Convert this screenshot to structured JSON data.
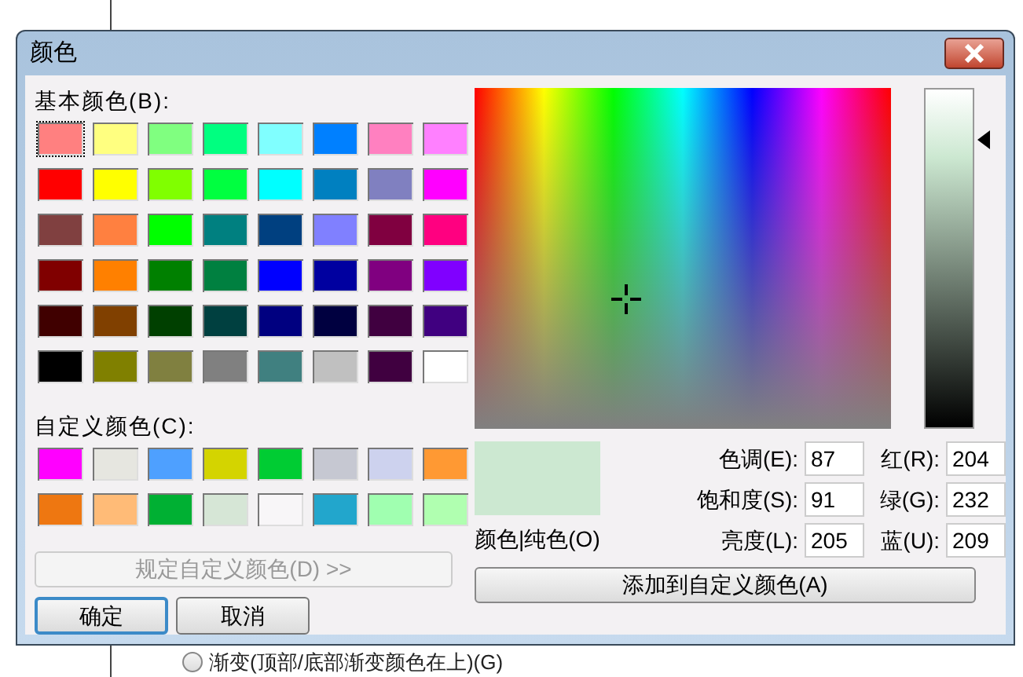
{
  "background_window": {
    "radio": {
      "label": "渐变(顶部/底部渐变颜色在上)(G)",
      "selected": false
    }
  },
  "window": {
    "title": "颜色"
  },
  "basic_colors": {
    "label": "基本颜色(B):",
    "swatches": [
      {
        "color": "#ff8080",
        "selected": true
      },
      {
        "color": "#ffff80",
        "selected": false
      },
      {
        "color": "#80ff80",
        "selected": false
      },
      {
        "color": "#00ff80",
        "selected": false
      },
      {
        "color": "#80ffff",
        "selected": false
      },
      {
        "color": "#0080ff",
        "selected": false
      },
      {
        "color": "#ff80c0",
        "selected": false
      },
      {
        "color": "#ff80ff",
        "selected": false
      },
      {
        "color": "#ff0000",
        "selected": false
      },
      {
        "color": "#ffff00",
        "selected": false
      },
      {
        "color": "#80ff00",
        "selected": false
      },
      {
        "color": "#00ff40",
        "selected": false
      },
      {
        "color": "#00ffff",
        "selected": false
      },
      {
        "color": "#0080c0",
        "selected": false
      },
      {
        "color": "#8080c0",
        "selected": false
      },
      {
        "color": "#ff00ff",
        "selected": false
      },
      {
        "color": "#804040",
        "selected": false
      },
      {
        "color": "#ff8040",
        "selected": false
      },
      {
        "color": "#00ff00",
        "selected": false
      },
      {
        "color": "#008080",
        "selected": false
      },
      {
        "color": "#004080",
        "selected": false
      },
      {
        "color": "#8080ff",
        "selected": false
      },
      {
        "color": "#800040",
        "selected": false
      },
      {
        "color": "#ff0080",
        "selected": false
      },
      {
        "color": "#800000",
        "selected": false
      },
      {
        "color": "#ff8000",
        "selected": false
      },
      {
        "color": "#008000",
        "selected": false
      },
      {
        "color": "#008040",
        "selected": false
      },
      {
        "color": "#0000ff",
        "selected": false
      },
      {
        "color": "#0000a0",
        "selected": false
      },
      {
        "color": "#800080",
        "selected": false
      },
      {
        "color": "#8000ff",
        "selected": false
      },
      {
        "color": "#400000",
        "selected": false
      },
      {
        "color": "#804000",
        "selected": false
      },
      {
        "color": "#004000",
        "selected": false
      },
      {
        "color": "#004040",
        "selected": false
      },
      {
        "color": "#000080",
        "selected": false
      },
      {
        "color": "#000040",
        "selected": false
      },
      {
        "color": "#400040",
        "selected": false
      },
      {
        "color": "#400080",
        "selected": false
      },
      {
        "color": "#000000",
        "selected": false
      },
      {
        "color": "#808000",
        "selected": false
      },
      {
        "color": "#808040",
        "selected": false
      },
      {
        "color": "#808080",
        "selected": false
      },
      {
        "color": "#408080",
        "selected": false
      },
      {
        "color": "#c0c0c0",
        "selected": false
      },
      {
        "color": "#400040",
        "selected": false
      },
      {
        "color": "#ffffff",
        "selected": false
      }
    ]
  },
  "custom_colors": {
    "label": "自定义颜色(C):",
    "swatches": [
      {
        "color": "#ff00ff"
      },
      {
        "color": "#e6e6e0"
      },
      {
        "color": "#4ea0ff"
      },
      {
        "color": "#d4d400"
      },
      {
        "color": "#00cc33"
      },
      {
        "color": "#c6c8d2"
      },
      {
        "color": "#cdd2ee"
      },
      {
        "color": "#ff9933"
      },
      {
        "color": "#ee7711"
      },
      {
        "color": "#ffbb77"
      },
      {
        "color": "#00b033"
      },
      {
        "color": "#d6e6d6"
      },
      {
        "color": "#f8f6f8"
      },
      {
        "color": "#22a6cc"
      },
      {
        "color": "#a0ffb0"
      },
      {
        "color": "#b0ffb0"
      }
    ]
  },
  "define_custom_button": {
    "label": "规定自定义颜色(D) >>",
    "disabled": true
  },
  "buttons": [
    {
      "label": "确定",
      "default": true
    },
    {
      "label": "取消",
      "default": false
    }
  ],
  "picker": {
    "luminance_slider": {
      "level": 0.854
    },
    "swatch_label": "颜色|纯色(O)",
    "fields": [
      {
        "label": "色调(E):",
        "value": "87"
      },
      {
        "label": "红(R):",
        "value": "204"
      },
      {
        "label": "饱和度(S):",
        "value": "91"
      },
      {
        "label": "绿(G):",
        "value": "232"
      },
      {
        "label": "亮度(L):",
        "value": "205"
      },
      {
        "label": "蓝(U):",
        "value": "209"
      }
    ],
    "add_button": "添加到自定义颜色(A)"
  }
}
